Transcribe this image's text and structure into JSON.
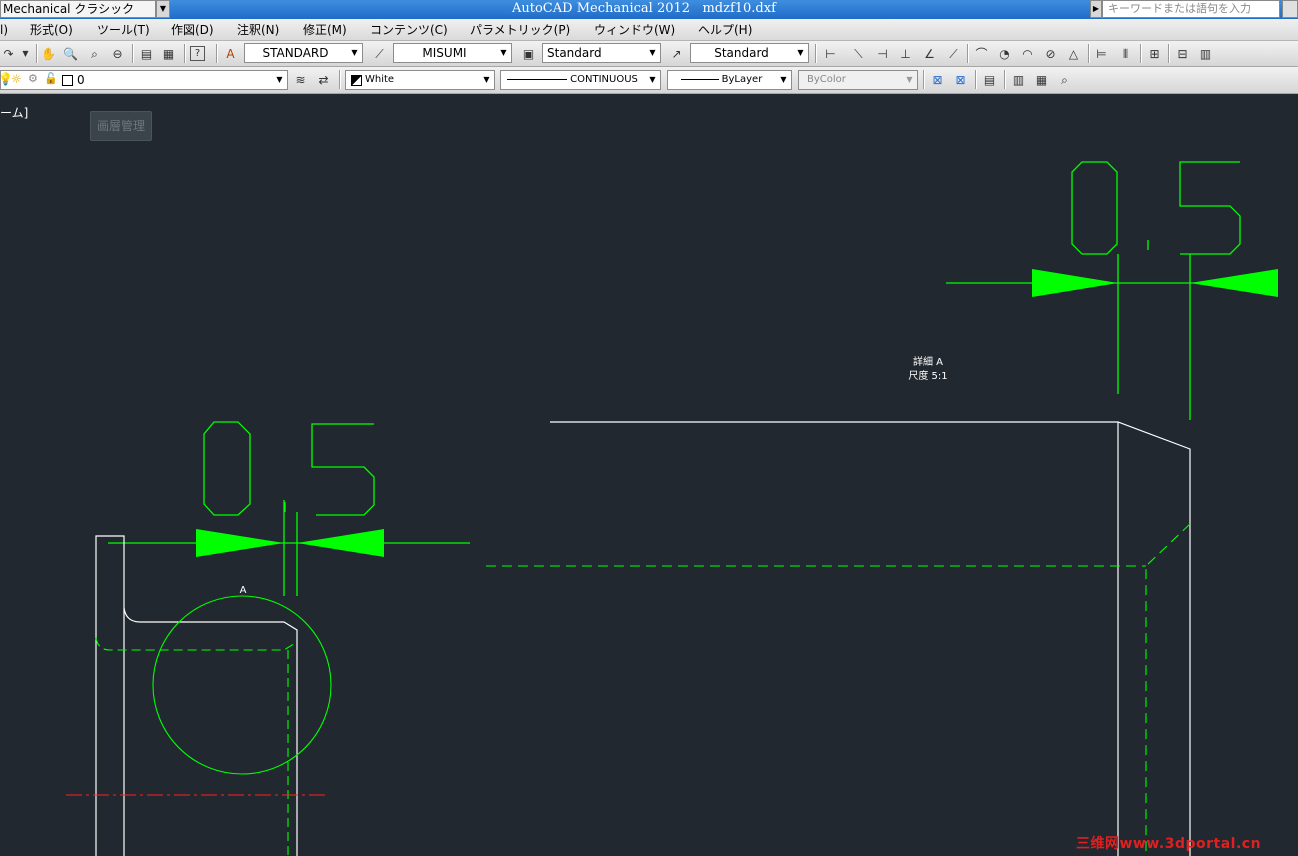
{
  "titlebar": {
    "workspace": "Mechanical クラシック",
    "title": "AutoCAD Mechanical 2012",
    "filename": "mdzf10.dxf",
    "search_placeholder": "キーワードまたは語句を入力"
  },
  "menubar": {
    "items": [
      "l)",
      "形式(O)",
      "ツール(T)",
      "作図(D)",
      "注釈(N)",
      "修正(M)",
      "コンテンツ(C)",
      "パラメトリック(P)",
      "ウィンドウ(W)",
      "ヘルプ(H)"
    ]
  },
  "toolbar1": {
    "text_style": "STANDARD",
    "dim_style": "MISUMI",
    "table_style": "Standard",
    "mleader_style": "Standard"
  },
  "toolbar2": {
    "layer": "0",
    "color": "White",
    "linetype": "CONTINUOUS",
    "lineweight": "ByLayer",
    "plotstyle": "ByColor"
  },
  "viewport": {
    "label": "ーム]",
    "ghost_button": "画層管理"
  },
  "drawing": {
    "dim_top_right": "0.5",
    "dim_left": "0.5",
    "detail_title": "詳細 A",
    "detail_scale": "尺度 5:1",
    "detail_marker": "A",
    "colors": {
      "background": "#212830",
      "dimension": "#00ff00",
      "geometry": "#ffffff",
      "hidden": "#00ff00",
      "center": "#ff2020"
    }
  },
  "watermark": "三维网www.3dportal.cn"
}
